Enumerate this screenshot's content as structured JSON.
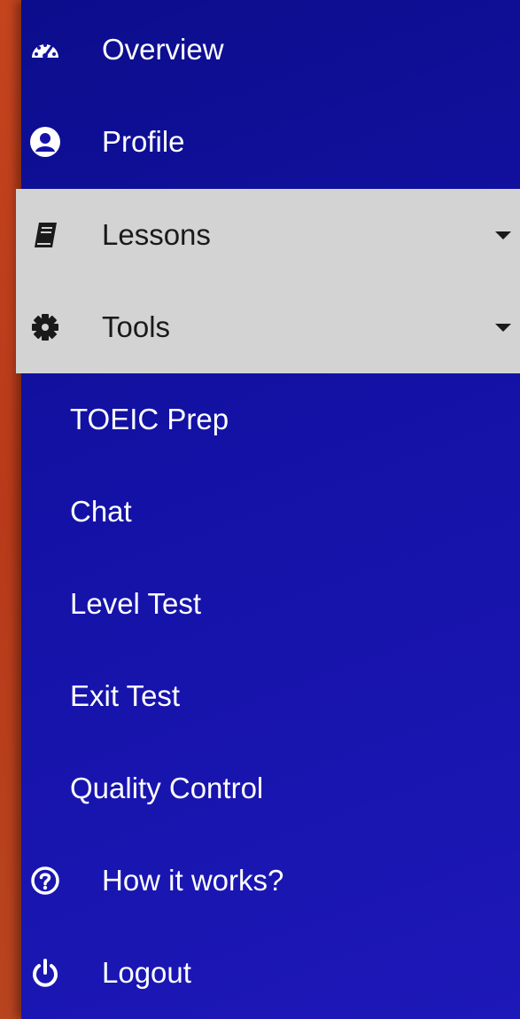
{
  "sidebar": {
    "items": [
      {
        "label": "Overview",
        "icon": "dashboard-icon"
      },
      {
        "label": "Profile",
        "icon": "user-circle-icon"
      },
      {
        "label": "Lessons",
        "icon": "book-icon",
        "expanded": true
      },
      {
        "label": "Tools",
        "icon": "gear-icon",
        "expanded": true
      },
      {
        "label": "How it works?",
        "icon": "question-circle-icon"
      },
      {
        "label": "Logout",
        "icon": "power-icon"
      }
    ],
    "submenu": [
      {
        "label": "TOEIC Prep"
      },
      {
        "label": "Chat"
      },
      {
        "label": "Level Test"
      },
      {
        "label": "Exit Test"
      },
      {
        "label": "Quality Control"
      }
    ]
  },
  "colors": {
    "sidebar_bg": "#1412a6",
    "expanded_bg": "#d3d3d3",
    "left_strip": "#c4441e",
    "text_light": "#ffffff",
    "text_dark": "#1a1a1a"
  }
}
